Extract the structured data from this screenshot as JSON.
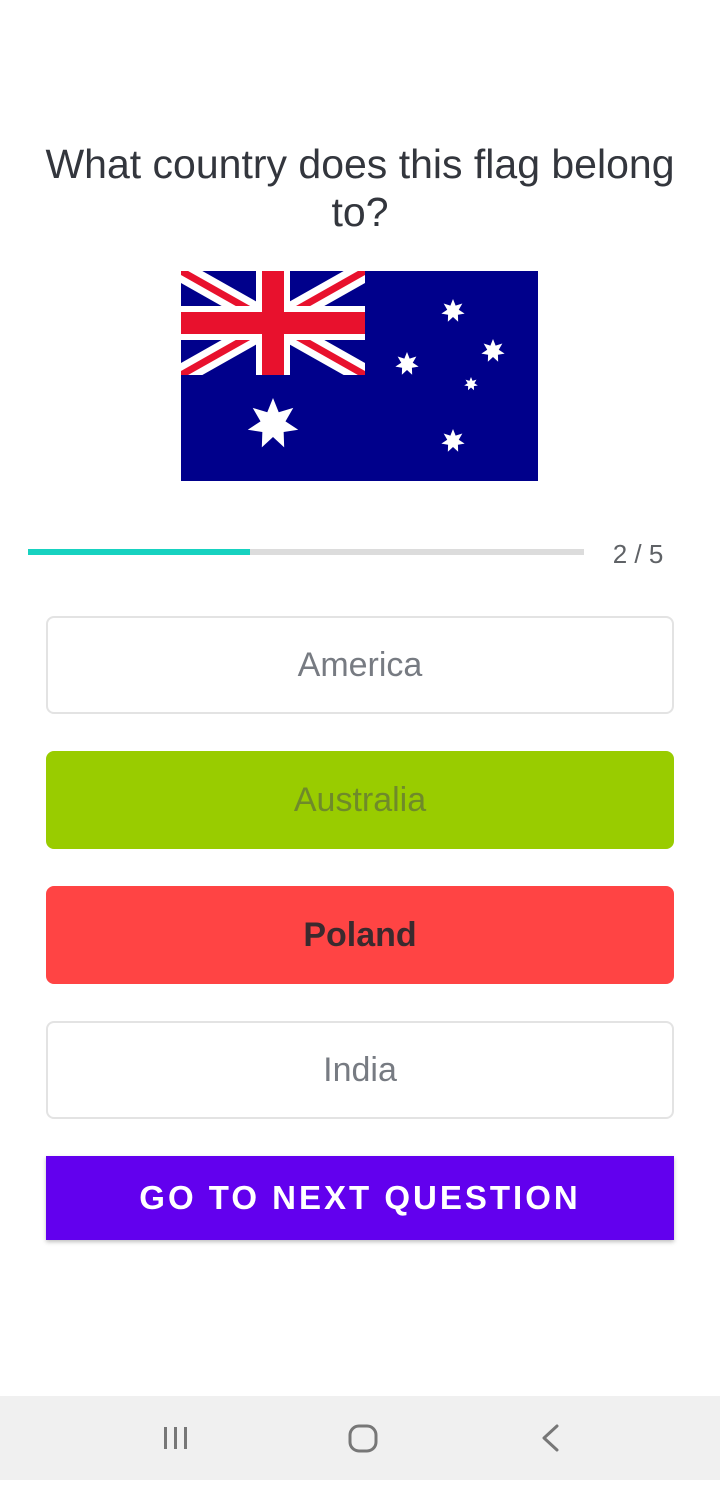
{
  "question": "What country does this flag belong to?",
  "flag": {
    "icon": "australia-flag-icon"
  },
  "progress": {
    "current": 2,
    "total": 5,
    "fraction": 0.4,
    "label": "2 / 5",
    "color": "#17d2c0"
  },
  "answers": [
    {
      "label": "America",
      "state": "default"
    },
    {
      "label": "Australia",
      "state": "correct",
      "color": "#99cc00"
    },
    {
      "label": "Poland",
      "state": "wrong",
      "color": "#ff4444"
    },
    {
      "label": "India",
      "state": "default"
    }
  ],
  "next_button": {
    "label": "GO TO NEXT QUESTION",
    "color": "#6200ee"
  },
  "nav": {
    "recents_icon": "recent-apps-icon",
    "home_icon": "home-icon",
    "back_icon": "back-icon"
  }
}
